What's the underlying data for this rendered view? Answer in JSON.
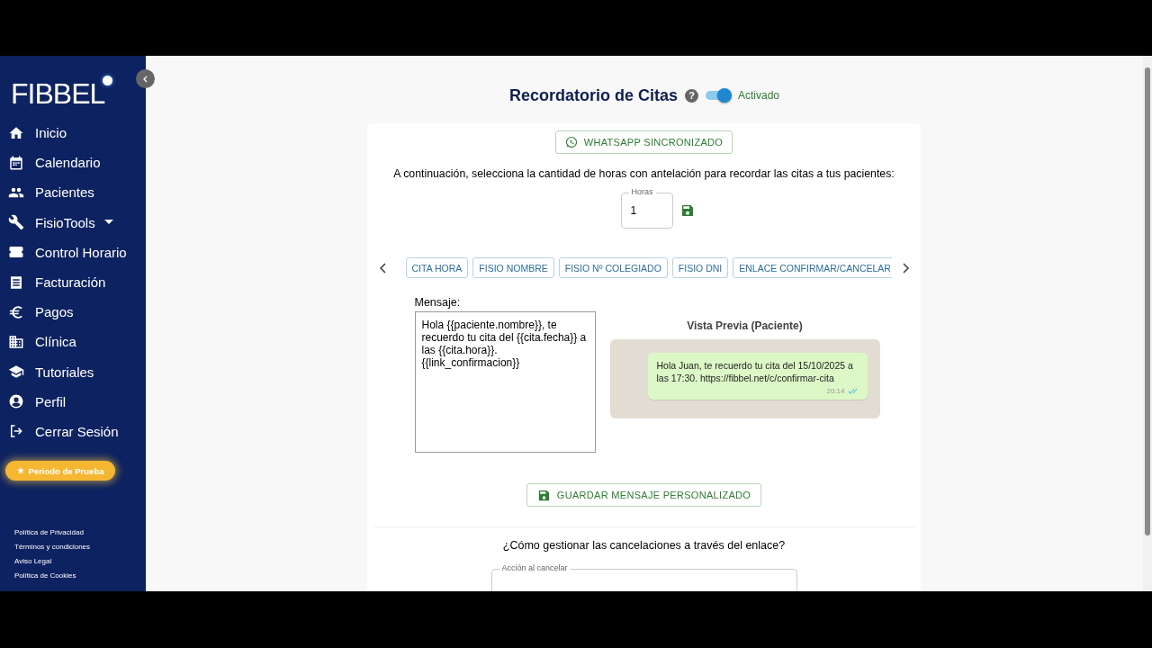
{
  "sidebar": {
    "logo": "FIBBEL",
    "items": [
      {
        "label": "Inicio",
        "selected": false,
        "dropdown": false
      },
      {
        "label": "Calendario",
        "selected": false,
        "dropdown": false
      },
      {
        "label": "Pacientes",
        "selected": false,
        "dropdown": false
      },
      {
        "label": "FisioTools",
        "selected": false,
        "dropdown": true
      },
      {
        "label": "Control Horario",
        "selected": false,
        "dropdown": false
      },
      {
        "label": "Facturación",
        "selected": false,
        "dropdown": false
      },
      {
        "label": "Pagos",
        "selected": false,
        "dropdown": false
      },
      {
        "label": "Clínica",
        "selected": false,
        "dropdown": false
      },
      {
        "label": "Tutoriales",
        "selected": false,
        "dropdown": false
      },
      {
        "label": "Perfil",
        "selected": false,
        "dropdown": false
      },
      {
        "label": "Cerrar Sesión",
        "selected": false,
        "dropdown": false
      }
    ],
    "trial_button": {
      "icon": "★",
      "label": "Periodo de Prueba"
    },
    "footer_links": [
      "Política de Privacidad",
      "Términos y condiciones",
      "Aviso Legal",
      "Política de Cookies"
    ]
  },
  "header": {
    "title": "Recordatorio de Citas",
    "help": "?",
    "toggle": {
      "on": true,
      "label": "Activado"
    }
  },
  "whatsapp_button": "WHATSAPP SINCRONIZADO",
  "instruction": "A continuación, selecciona la cantidad de horas con antelación para recordar las citas a tus pacientes:",
  "hours_field": {
    "label": "Horas",
    "value": "1"
  },
  "variable_chips": [
    "CITA HORA",
    "FISIO NOMBRE",
    "FISIO Nº COLEGIADO",
    "FISIO DNI",
    "ENLACE CONFIRMAR/CANCELAR"
  ],
  "message": {
    "label": "Mensaje:",
    "value": "Hola {{paciente.nombre}}, te recuerdo tu cita del {{cita.fecha}} a las {{cita.hora}}.\n{{link_confirmacion}}"
  },
  "preview": {
    "title": "Vista Previa (Paciente)",
    "text": "Hola Juan, te recuerdo tu cita del 15/10/2025 a las 17:30. https://fibbel.net/c/confirmar-cita",
    "time": "20:14",
    "read": true
  },
  "save_message_button": "GUARDAR MENSAJE PERSONALIZADO",
  "cancellation": {
    "question": "¿Cómo gestionar las cancelaciones a través del enlace?",
    "field_label": "Acción al cancelar"
  }
}
